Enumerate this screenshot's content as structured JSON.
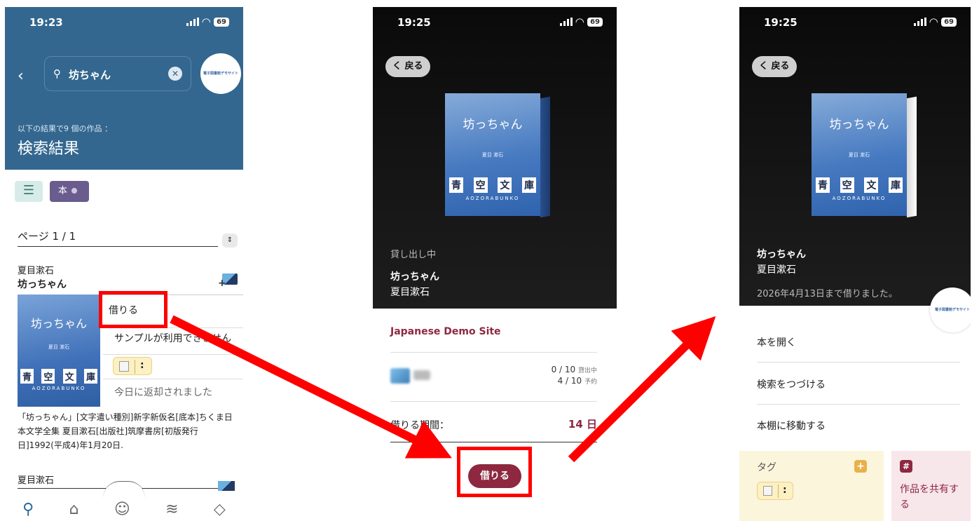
{
  "status": {
    "time1": "19:23",
    "time2": "19:25",
    "time3": "19:25",
    "battery": "69"
  },
  "panel1": {
    "search_value": "坊ちゃん",
    "logo_text": "電子図書館デモサイト",
    "result_count": "以下の結果で9 個の作品 ：",
    "result_title": "検索結果",
    "chip_label": "本",
    "page_label": "ページ 1 / 1",
    "book1": {
      "author": "夏目漱石",
      "title": "坊っちゃん",
      "cover_title": "坊っちゃん",
      "cover_author": "夏目 漱石",
      "cover_brand": [
        "青",
        "空",
        "文",
        "庫"
      ],
      "cover_sub": "AOZORABUNKO"
    },
    "menu": {
      "borrow": "借りる",
      "sample": "サンプルが利用できません",
      "returned": "今日に返却されました"
    },
    "description": "「坊っちゃん」[文字遣い種別]新字新仮名[底本]ちくま日本文学全集 夏目漱石[出版社]筑摩書房[初版発行日]1992(平成4)年1月20日.",
    "book2_author": "夏目漱石",
    "nav": [
      "search-icon",
      "library-icon",
      "face-icon",
      "books-icon",
      "tag-icon"
    ]
  },
  "panel2": {
    "back": "く 戻る",
    "loan_status": "貸し出し中",
    "title": "坊っちゃん",
    "author": "夏目漱石",
    "site_name": "Japanese Demo Site",
    "loan_count": "0 / 10",
    "loan_count_label": "貸出中",
    "reserve_count": "4 / 10",
    "reserve_count_label": "予約",
    "period_label": "借りる期間：",
    "period_value": "14 日",
    "borrow_button": "借りる"
  },
  "panel3": {
    "back": "く 戻る",
    "title": "坊っちゃん",
    "author": "夏目漱石",
    "due": "2026年4月13日まで借りました。",
    "open_book": "本を開く",
    "continue_search": "検索をつづける",
    "go_shelf": "本棚に移動する",
    "tag_label": "タグ",
    "share_label": "作品を共有する",
    "logo_text": "電子図書館デモサイト"
  },
  "colors": {
    "header_blue": "#33678f",
    "accent_red": "#8d2840",
    "highlight": "#ff0000"
  }
}
